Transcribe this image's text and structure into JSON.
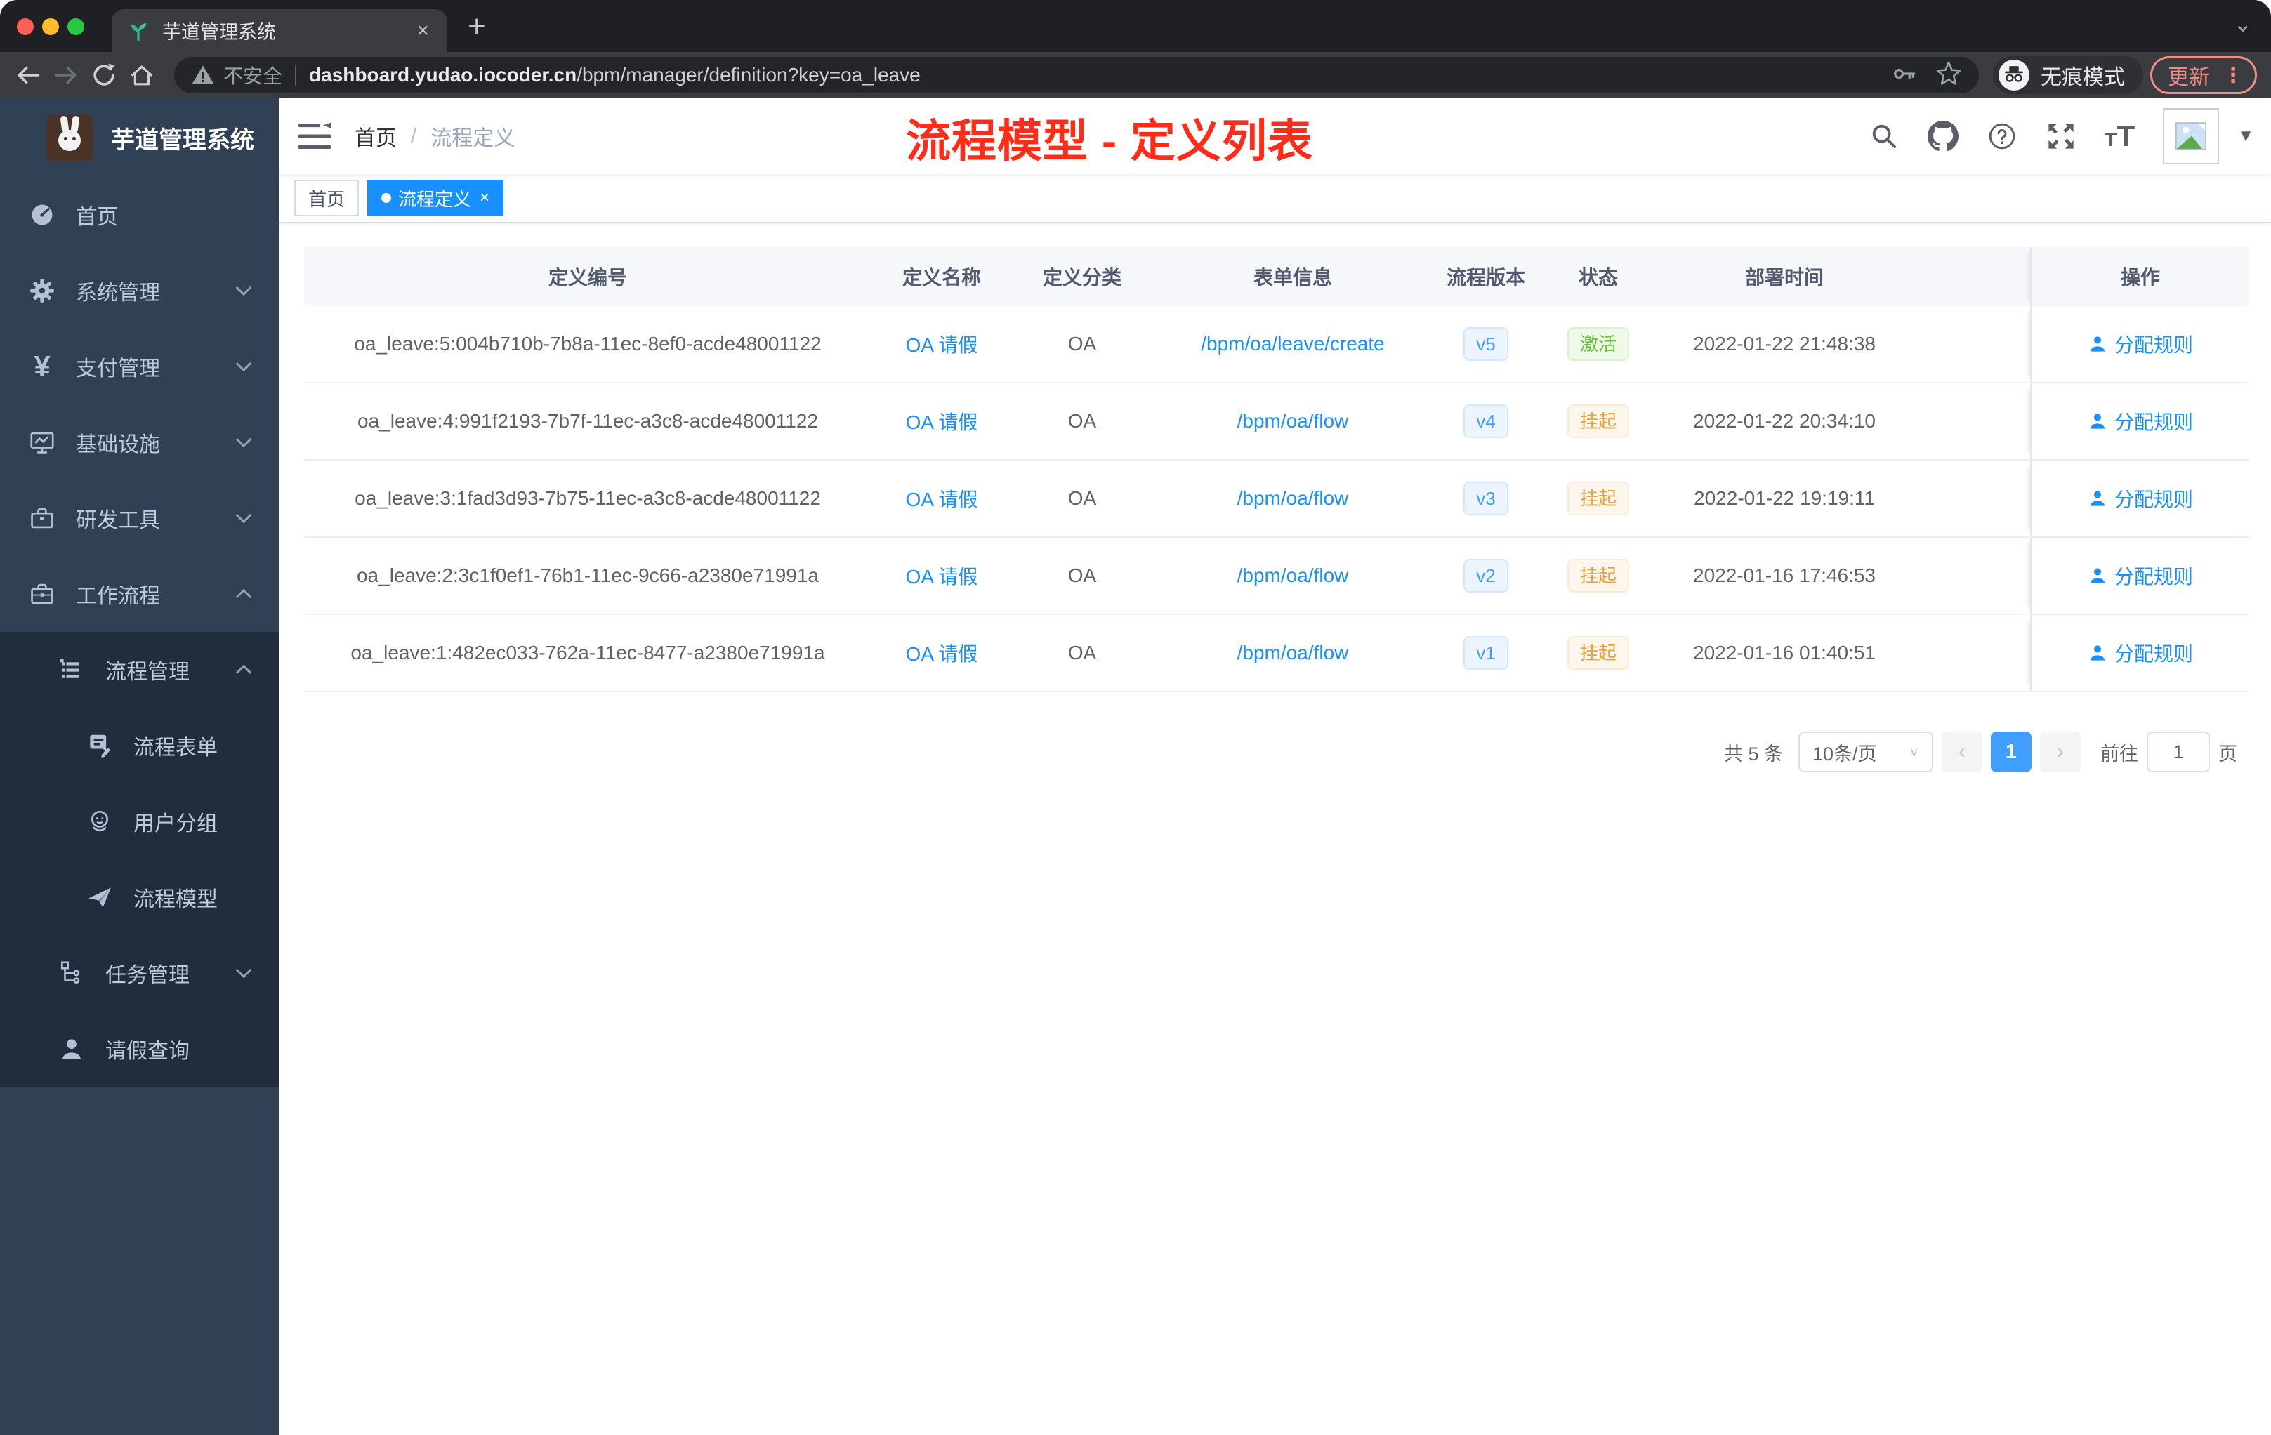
{
  "colors": {
    "accent_blue": "#1890ff",
    "element_blue": "#409eff",
    "success_green": "#67c23a",
    "warning_orange": "#e6a23c",
    "title_red": "#fe2c19",
    "sidebar_bg": "#304156",
    "submenu_bg": "#1f2d3d",
    "update_salmon": "#f28b82",
    "tag_active_bg": "#1890ff"
  },
  "glyphs": {
    "close": "×",
    "plus": "+",
    "chevron_down": "⌄",
    "caret_down": "▼",
    "dots": "⋮",
    "slash": "/",
    "prev": "‹",
    "next": "›"
  },
  "browser": {
    "tab": {
      "title": "芋道管理系统"
    },
    "security_label": "不安全",
    "url_domain": "dashboard.yudao.iocoder.cn",
    "url_path": "/bpm/manager/definition?key=oa_leave",
    "incognito_label": "无痕模式",
    "update_label": "更新"
  },
  "sidebar": {
    "logo_title": "芋道管理系统",
    "menu": [
      {
        "label": "首页",
        "icon": "dashboard-icon"
      },
      {
        "label": "系统管理",
        "icon": "gear-icon"
      },
      {
        "label": "支付管理",
        "icon": "yuan-icon"
      },
      {
        "label": "基础设施",
        "icon": "monitor-icon"
      },
      {
        "label": "研发工具",
        "icon": "toolbox-icon"
      },
      {
        "label": "工作流程",
        "icon": "briefcase-icon"
      },
      {
        "label": "流程管理",
        "icon": "list-icon"
      },
      {
        "label": "流程表单",
        "icon": "form-icon"
      },
      {
        "label": "用户分组",
        "icon": "user-group-icon"
      },
      {
        "label": "流程模型",
        "icon": "paper-plane-icon"
      },
      {
        "label": "任务管理",
        "icon": "tree-icon"
      },
      {
        "label": "请假查询",
        "icon": "person-icon"
      }
    ]
  },
  "navbar": {
    "breadcrumb": {
      "home": "首页",
      "current": "流程定义"
    }
  },
  "overlay_title": "流程模型 - 定义列表",
  "tags": {
    "home": "首页",
    "active": "流程定义"
  },
  "table": {
    "headers": {
      "id": "定义编号",
      "name": "定义名称",
      "category": "定义分类",
      "form": "表单信息",
      "version": "流程版本",
      "status": "状态",
      "deploy_time": "部署时间",
      "actions": "操作"
    },
    "action_label": "分配规则",
    "rows": [
      {
        "id": "oa_leave:5:004b710b-7b8a-11ec-8ef0-acde48001122",
        "name": "OA 请假",
        "category": "OA",
        "form": "/bpm/oa/leave/create",
        "version": "v5",
        "status": "激活",
        "status_variant": "success",
        "deploy_time": "2022-01-22 21:48:38"
      },
      {
        "id": "oa_leave:4:991f2193-7b7f-11ec-a3c8-acde48001122",
        "name": "OA 请假",
        "category": "OA",
        "form": "/bpm/oa/flow",
        "version": "v4",
        "status": "挂起",
        "status_variant": "warning",
        "deploy_time": "2022-01-22 20:34:10"
      },
      {
        "id": "oa_leave:3:1fad3d93-7b75-11ec-a3c8-acde48001122",
        "name": "OA 请假",
        "category": "OA",
        "form": "/bpm/oa/flow",
        "version": "v3",
        "status": "挂起",
        "status_variant": "warning",
        "deploy_time": "2022-01-22 19:19:11"
      },
      {
        "id": "oa_leave:2:3c1f0ef1-76b1-11ec-9c66-a2380e71991a",
        "name": "OA 请假",
        "category": "OA",
        "form": "/bpm/oa/flow",
        "version": "v2",
        "status": "挂起",
        "status_variant": "warning",
        "deploy_time": "2022-01-16 17:46:53"
      },
      {
        "id": "oa_leave:1:482ec033-762a-11ec-8477-a2380e71991a",
        "name": "OA 请假",
        "category": "OA",
        "form": "/bpm/oa/flow",
        "version": "v1",
        "status": "挂起",
        "status_variant": "warning",
        "deploy_time": "2022-01-16 01:40:51"
      }
    ]
  },
  "pagination": {
    "total": "共 5 条",
    "page_size": "10条/页",
    "page": "1",
    "goto_label": "前往",
    "goto_value": "1",
    "unit_label": "页"
  }
}
